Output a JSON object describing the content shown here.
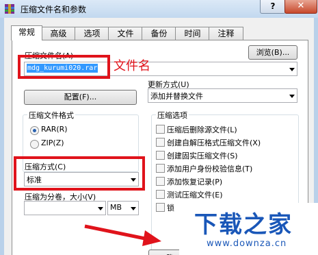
{
  "title_bar": {
    "title": "压缩文件名和参数",
    "help_label": "?",
    "close_label": "✕"
  },
  "tabs": [
    "常规",
    "高级",
    "选项",
    "文件",
    "备份",
    "时间",
    "注释"
  ],
  "general": {
    "archive_name_label": "压缩文件名(A)",
    "archive_name_value": "mdg_kurumi020.rar",
    "browse_label": "浏览(B)...",
    "update_mode_label": "更新方式(U)",
    "update_mode_value": "添加并替换文件",
    "profile_label": "配置(F)...",
    "format_group_title": "压缩文件格式",
    "format_options": [
      "RAR(R)",
      "ZIP(Z)"
    ],
    "format_selected": "RAR(R)",
    "method_label": "压缩方式(C)",
    "method_value": "标准",
    "split_label": "压缩为分卷，大小(V)",
    "split_value": "",
    "split_unit": "MB",
    "options_group_title": "压缩选项",
    "options": [
      "压缩后删除源文件(L)",
      "创建自解压格式压缩文件(X)",
      "创建固实压缩文件(S)",
      "添加用户身份校验信息(T)",
      "添加恢复记录(P)",
      "测试压缩文件(E)",
      "锁"
    ],
    "ok_label": "确"
  },
  "annotation": {
    "filename_note": "文件名",
    "color": "#e0131b"
  },
  "watermark": {
    "brand": "下载之家",
    "url": "www.downza.cn"
  }
}
